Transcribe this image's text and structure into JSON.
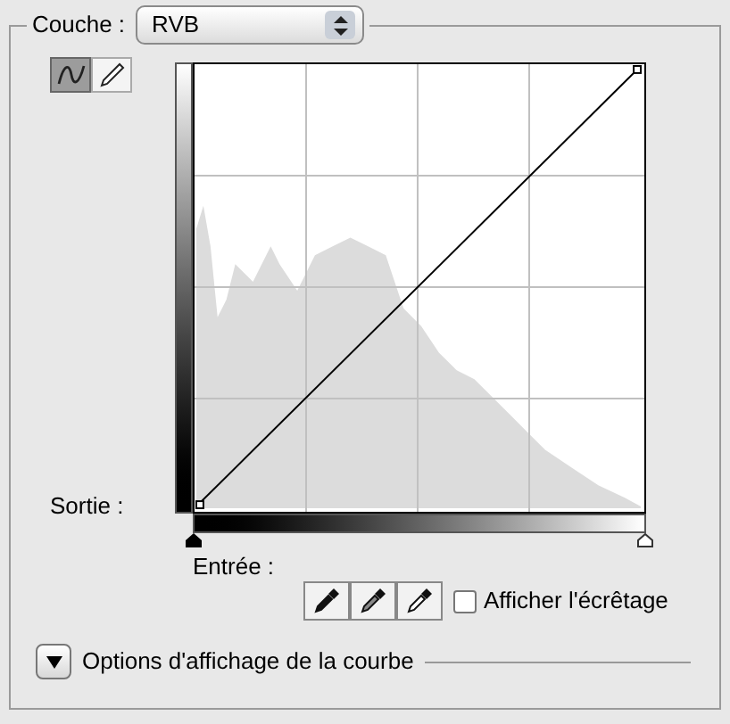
{
  "channel": {
    "label": "Couche :",
    "value": "RVB"
  },
  "tools": [
    {
      "kind": "curve",
      "selected": true
    },
    {
      "kind": "pencil",
      "selected": false
    }
  ],
  "output_label": "Sortie :",
  "input_label": "Entrée :",
  "eyedroppers": [
    {
      "kind": "black"
    },
    {
      "kind": "gray"
    },
    {
      "kind": "white"
    }
  ],
  "show_clipping": {
    "label": "Afficher l'écrêtage",
    "checked": false
  },
  "display_options": {
    "label": "Options d'affichage de la courbe",
    "expanded": false
  }
}
